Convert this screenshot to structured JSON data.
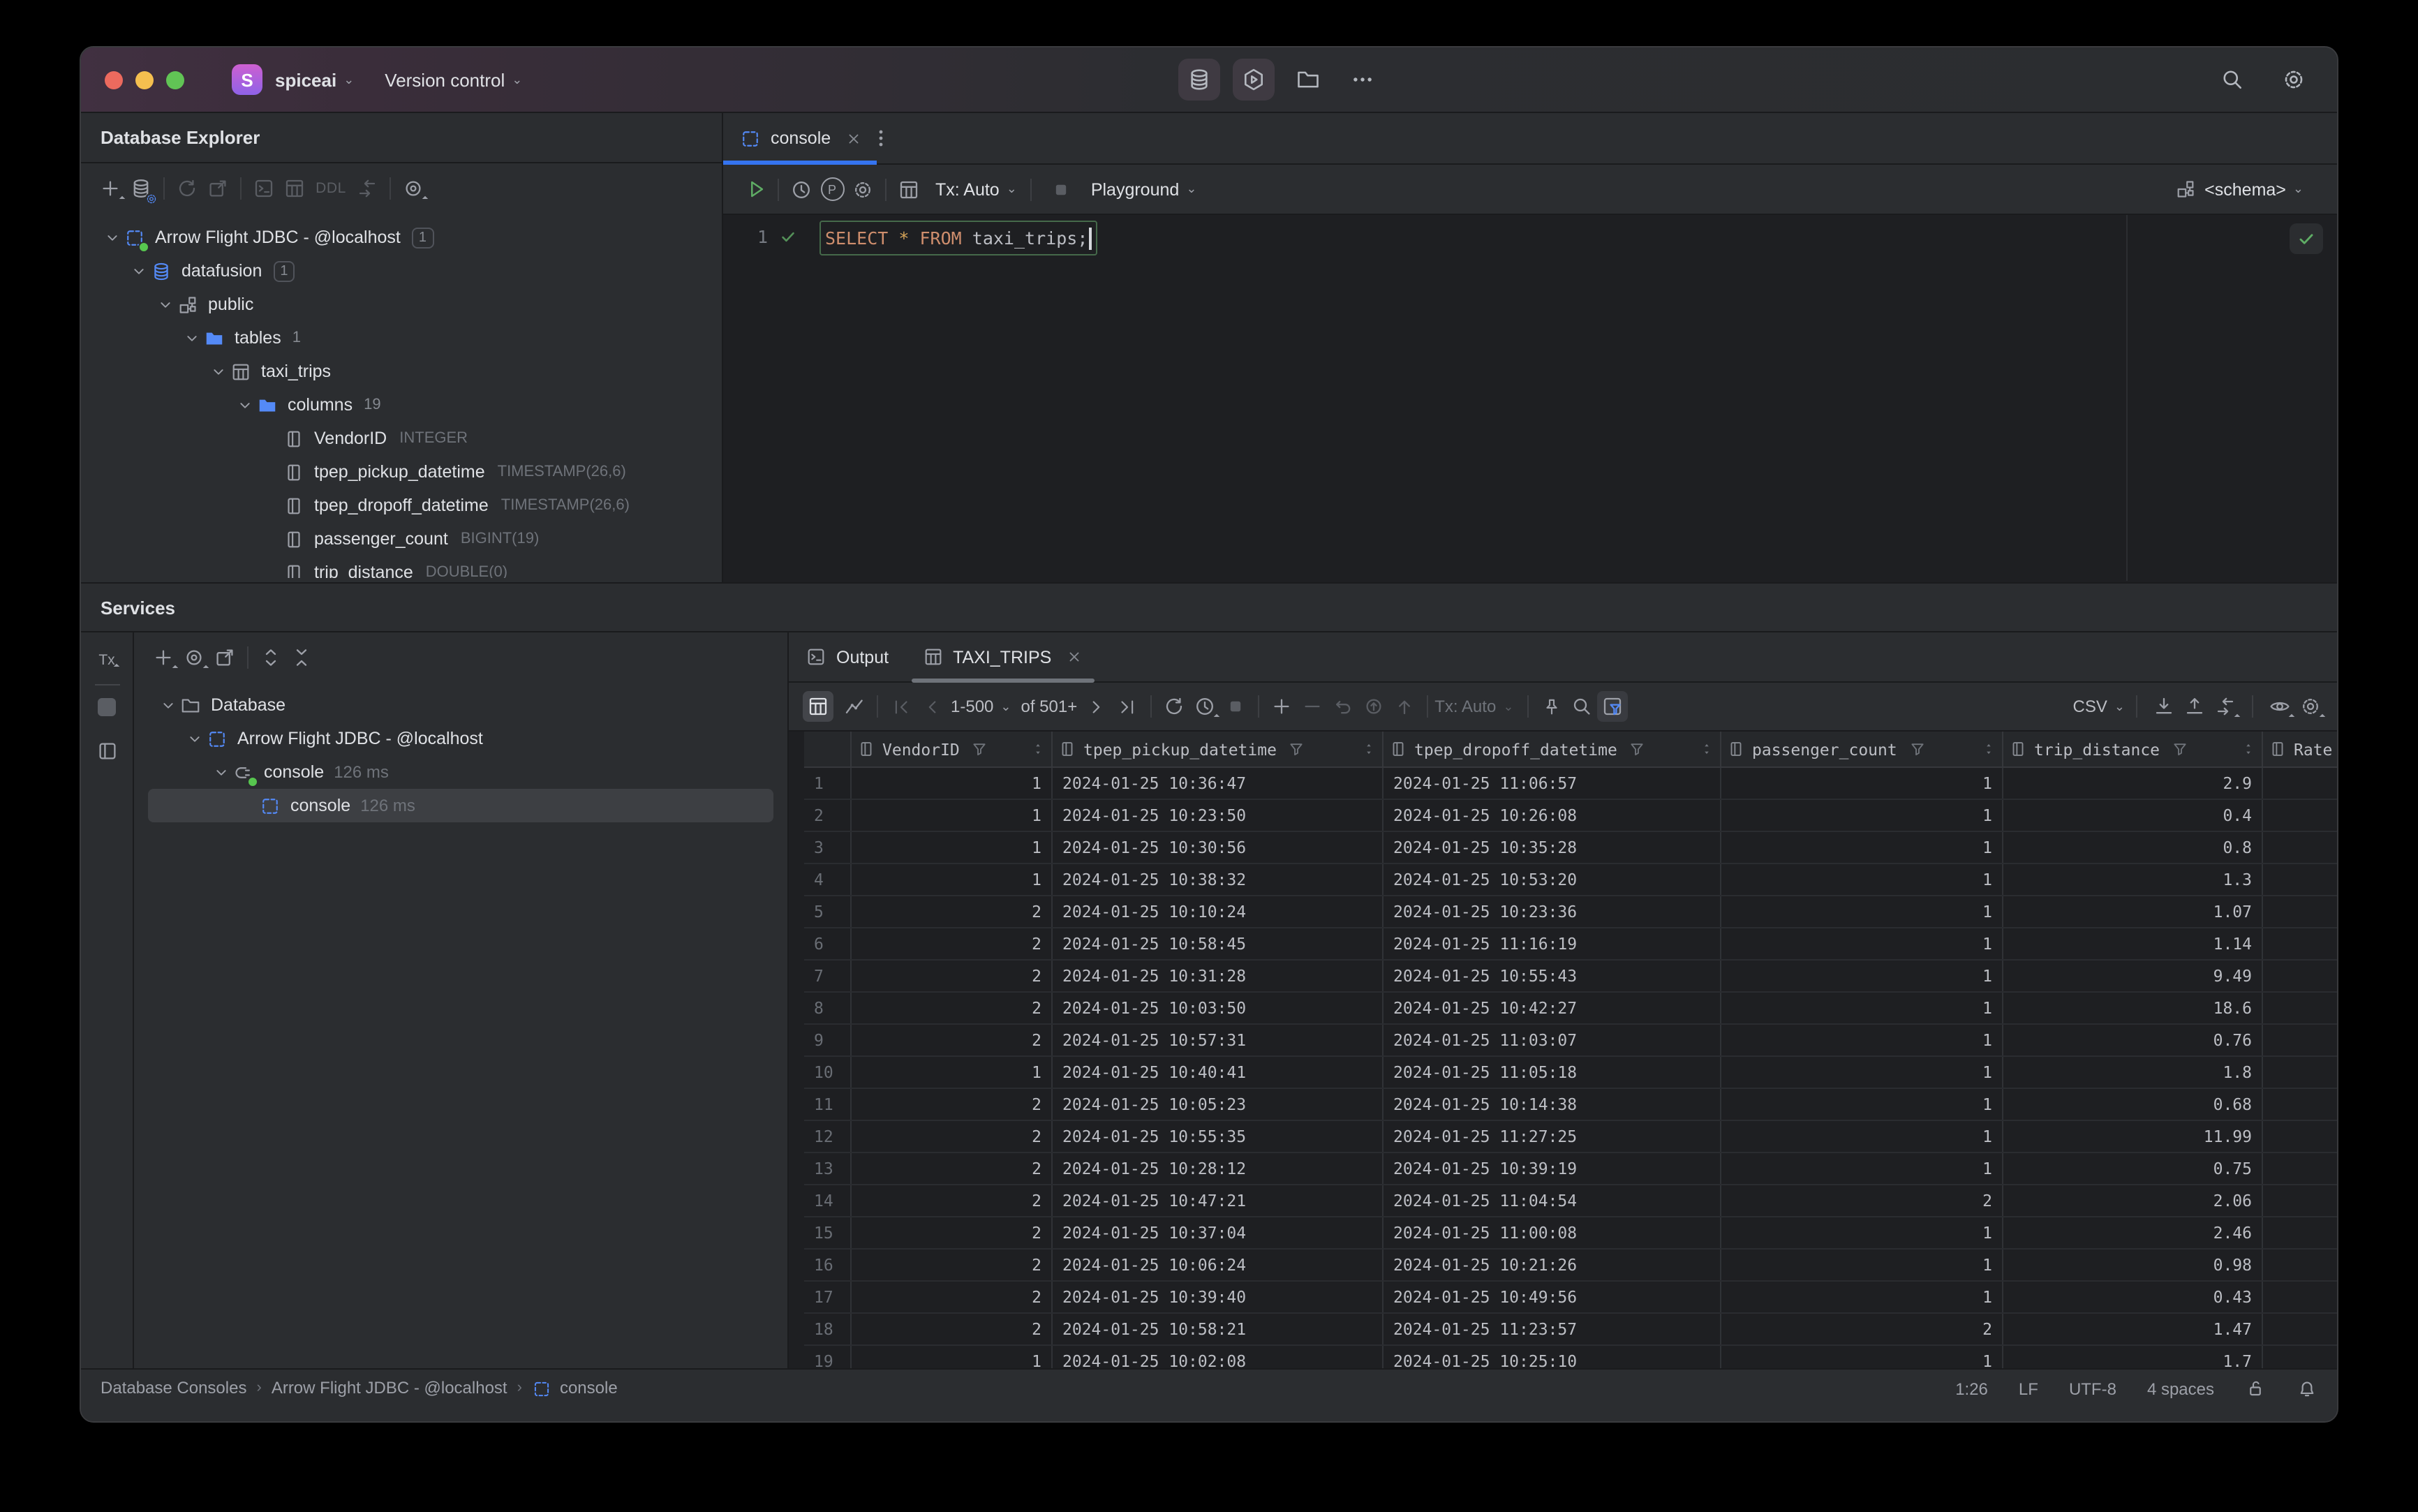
{
  "titlebar": {
    "project_initial": "S",
    "project": "spiceai",
    "menu": "Version control"
  },
  "explorer": {
    "title": "Database Explorer",
    "toolbar": {
      "ddl": "DDL"
    },
    "tree": [
      {
        "level": 0,
        "icon": "jdbc",
        "label": "Arrow Flight JDBC - @localhost",
        "badge": "1",
        "badge_boxed": true,
        "expanded": true,
        "dot": true
      },
      {
        "level": 1,
        "icon": "database",
        "label": "datafusion",
        "badge": "1",
        "badge_boxed": true,
        "expanded": true
      },
      {
        "level": 2,
        "icon": "schema",
        "label": "public",
        "expanded": true
      },
      {
        "level": 3,
        "icon": "folder",
        "label": "tables",
        "badge": "1",
        "expanded": true
      },
      {
        "level": 4,
        "icon": "table",
        "label": "taxi_trips",
        "expanded": true
      },
      {
        "level": 5,
        "icon": "folder",
        "label": "columns",
        "badge": "19",
        "expanded": true
      },
      {
        "level": 6,
        "icon": "column",
        "label": "VendorID",
        "type": "INTEGER"
      },
      {
        "level": 6,
        "icon": "column",
        "label": "tpep_pickup_datetime",
        "type": "TIMESTAMP(26,6)"
      },
      {
        "level": 6,
        "icon": "column",
        "label": "tpep_dropoff_datetime",
        "type": "TIMESTAMP(26,6)"
      },
      {
        "level": 6,
        "icon": "column",
        "label": "passenger_count",
        "type": "BIGINT(19)"
      },
      {
        "level": 6,
        "icon": "column",
        "label": "trip_distance",
        "type": "DOUBLE(0)"
      }
    ]
  },
  "editor": {
    "tab_label": "console",
    "toolbar": {
      "tx": "Tx: Auto",
      "playground": "Playground",
      "schema": "<schema>",
      "p_letter": "P"
    },
    "line_number": "1",
    "sql_tokens": [
      {
        "text": "SELECT",
        "style": "kw"
      },
      {
        "text": " ",
        "style": "plain"
      },
      {
        "text": "*",
        "style": "star"
      },
      {
        "text": " ",
        "style": "plain"
      },
      {
        "text": "FROM",
        "style": "kw"
      },
      {
        "text": " ",
        "style": "plain"
      },
      {
        "text": "taxi_trips",
        "style": "plain"
      },
      {
        "text": ";",
        "style": "plain"
      }
    ]
  },
  "services": {
    "title": "Services",
    "left_strip_tx": "Tx",
    "tree": [
      {
        "level": 0,
        "icon": "folder-outline",
        "label": "Database",
        "expanded": true
      },
      {
        "level": 1,
        "icon": "jdbc",
        "label": "Arrow Flight JDBC - @localhost",
        "expanded": true
      },
      {
        "level": 2,
        "icon": "plug",
        "label": "console",
        "meta": "126 ms",
        "expanded": true,
        "dot": true
      },
      {
        "level": 3,
        "icon": "jdbc",
        "label": "console",
        "meta": "126 ms",
        "selected": true
      }
    ]
  },
  "results": {
    "tabs": [
      {
        "label": "Output"
      },
      {
        "label": "TAXI_TRIPS"
      }
    ],
    "toolbar": {
      "range": "1-500",
      "of_total": "of 501+",
      "tx": "Tx: Auto",
      "format": "CSV"
    },
    "grid": {
      "columns": [
        {
          "name": "VendorID",
          "align": "right"
        },
        {
          "name": "tpep_pickup_datetime",
          "align": "left"
        },
        {
          "name": "tpep_dropoff_datetime",
          "align": "left"
        },
        {
          "name": "passenger_count",
          "align": "right"
        },
        {
          "name": "trip_distance",
          "align": "right"
        },
        {
          "name": "Rate",
          "align": "left"
        }
      ],
      "rows": [
        [
          "1",
          "2024-01-25 10:36:47",
          "2024-01-25 11:06:57",
          "1",
          "2.9",
          ""
        ],
        [
          "1",
          "2024-01-25 10:23:50",
          "2024-01-25 10:26:08",
          "1",
          "0.4",
          ""
        ],
        [
          "1",
          "2024-01-25 10:30:56",
          "2024-01-25 10:35:28",
          "1",
          "0.8",
          ""
        ],
        [
          "1",
          "2024-01-25 10:38:32",
          "2024-01-25 10:53:20",
          "1",
          "1.3",
          ""
        ],
        [
          "2",
          "2024-01-25 10:10:24",
          "2024-01-25 10:23:36",
          "1",
          "1.07",
          ""
        ],
        [
          "2",
          "2024-01-25 10:58:45",
          "2024-01-25 11:16:19",
          "1",
          "1.14",
          ""
        ],
        [
          "2",
          "2024-01-25 10:31:28",
          "2024-01-25 10:55:43",
          "1",
          "9.49",
          ""
        ],
        [
          "2",
          "2024-01-25 10:03:50",
          "2024-01-25 10:42:27",
          "1",
          "18.6",
          ""
        ],
        [
          "2",
          "2024-01-25 10:57:31",
          "2024-01-25 11:03:07",
          "1",
          "0.76",
          ""
        ],
        [
          "1",
          "2024-01-25 10:40:41",
          "2024-01-25 11:05:18",
          "1",
          "1.8",
          ""
        ],
        [
          "2",
          "2024-01-25 10:05:23",
          "2024-01-25 10:14:38",
          "1",
          "0.68",
          ""
        ],
        [
          "2",
          "2024-01-25 10:55:35",
          "2024-01-25 11:27:25",
          "1",
          "11.99",
          ""
        ],
        [
          "2",
          "2024-01-25 10:28:12",
          "2024-01-25 10:39:19",
          "1",
          "0.75",
          ""
        ],
        [
          "2",
          "2024-01-25 10:47:21",
          "2024-01-25 11:04:54",
          "2",
          "2.06",
          ""
        ],
        [
          "2",
          "2024-01-25 10:37:04",
          "2024-01-25 11:00:08",
          "1",
          "2.46",
          ""
        ],
        [
          "2",
          "2024-01-25 10:06:24",
          "2024-01-25 10:21:26",
          "1",
          "0.98",
          ""
        ],
        [
          "2",
          "2024-01-25 10:39:40",
          "2024-01-25 10:49:56",
          "1",
          "0.43",
          ""
        ],
        [
          "2",
          "2024-01-25 10:58:21",
          "2024-01-25 11:23:57",
          "2",
          "1.47",
          ""
        ],
        [
          "1",
          "2024-01-25 10:02:08",
          "2024-01-25 10:25:10",
          "1",
          "1.7",
          ""
        ]
      ]
    }
  },
  "statusbar": {
    "breadcrumbs": [
      "Database Consoles",
      "Arrow Flight JDBC - @localhost",
      "console"
    ],
    "caret": "1:26",
    "eol": "LF",
    "encoding": "UTF-8",
    "indent": "4 spaces"
  },
  "colors": {
    "accent_blue": "#3574f0",
    "folder_blue": "#548af7",
    "run_green": "#5fad65",
    "keyword_orange": "#cf8e6d",
    "panel_bg": "#2b2d30",
    "editor_bg": "#1e1f22"
  }
}
